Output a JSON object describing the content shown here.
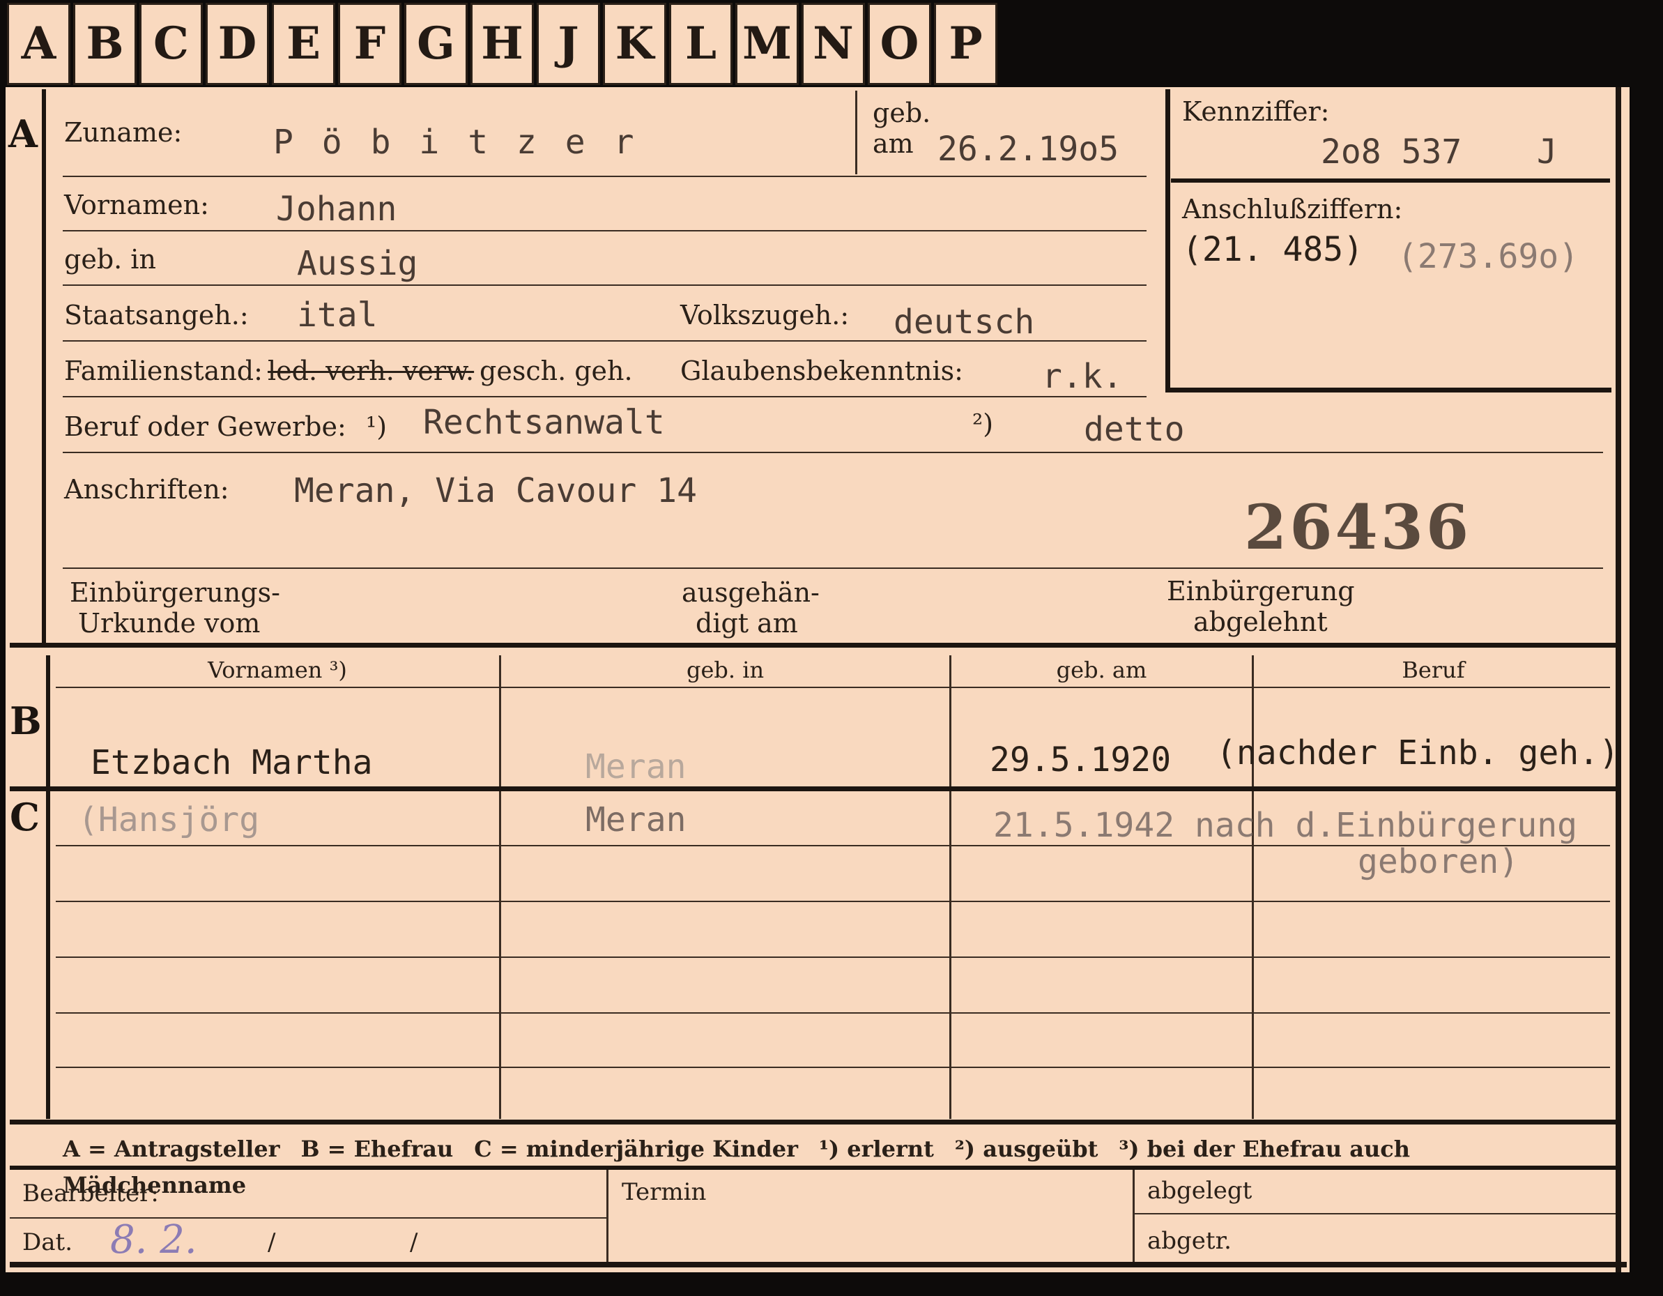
{
  "tabs": [
    "A",
    "B",
    "C",
    "D",
    "E",
    "F",
    "G",
    "H",
    "J",
    "K",
    "L",
    "M",
    "N",
    "O",
    "P"
  ],
  "section_a": {
    "marker": "A",
    "zuname_label": "Zuname:",
    "zuname_value": "P ö b i t z e r",
    "geb_label": "geb.",
    "am_label": "am",
    "geb_am_value": "26.2.19o5",
    "kennziffer_label": "Kennziffer:",
    "kennziffer_value": "2o8 537",
    "kennziffer_suffix": "J",
    "anschluss_label": "Anschlußziffern:",
    "anschluss_value_1": "(21. 485)",
    "anschluss_value_2": "(273.69o)",
    "vornamen_label": "Vornamen:",
    "vornamen_value": "Johann",
    "geb_in_label": "geb. in",
    "geb_in_value": "Aussig",
    "staatsangeh_label": "Staatsangeh.:",
    "staatsangeh_value": "ital",
    "volkszugeh_label": "Volkszugeh.:",
    "volkszugeh_value": "deutsch",
    "familienstand_label": "Familienstand:",
    "familienstand_struck": "led. verh. verw.",
    "familienstand_value": "gesch. geh.",
    "glaubens_label": "Glaubensbekenntnis:",
    "glaubens_value": "r.k.",
    "beruf_label": "Beruf oder Gewerbe:",
    "beruf_note1": "¹)",
    "beruf_value1": "Rechtsanwalt",
    "beruf_note2": "²)",
    "beruf_value2": "detto",
    "anschriften_label": "Anschriften:",
    "anschriften_value": "Meran, Via Cavour 14",
    "stamp_number": "26436",
    "einbuergerung_urkunde_label_1": "Einbürgerungs-",
    "einbuergerung_urkunde_label_2": "Urkunde vom",
    "ausgehaendigt_label_1": "ausgehän-",
    "ausgehaendigt_label_2": "digt am",
    "einbuergerung_abgelehnt_label_1": "Einbürgerung",
    "einbuergerung_abgelehnt_label_2": "abgelehnt"
  },
  "table": {
    "headers": [
      "Vornamen ³)",
      "geb. in",
      "geb. am",
      "Beruf"
    ],
    "section_b_marker": "B",
    "section_c_marker": "C",
    "b_row": {
      "vornamen": "Etzbach  Martha",
      "geb_in": "Meran",
      "geb_am": "29.5.1920",
      "beruf": "(nachder Einb. geh.)"
    },
    "c_row": {
      "vornamen": "(Hansjörg",
      "geb_in": "Meran",
      "geb_am": "21.5.1942 nach d.Einbürgerung",
      "beruf_line2": "geboren)"
    }
  },
  "legend": [
    "A = Antragsteller",
    "B = Ehefrau",
    "C = minderjährige Kinder",
    "¹) erlernt",
    "²) ausgeübt",
    "³) bei der Ehefrau auch Mädchenname"
  ],
  "footer": {
    "bearbeiter_label": "Bearbeiter:",
    "termin_label": "Termin",
    "abgelegt_label": "abgelegt",
    "dat_label": "Dat.",
    "dat_handwritten": "8. 2.",
    "dat_sep1": "/",
    "dat_sep2": "/",
    "abgetr_label": "abgetr."
  }
}
